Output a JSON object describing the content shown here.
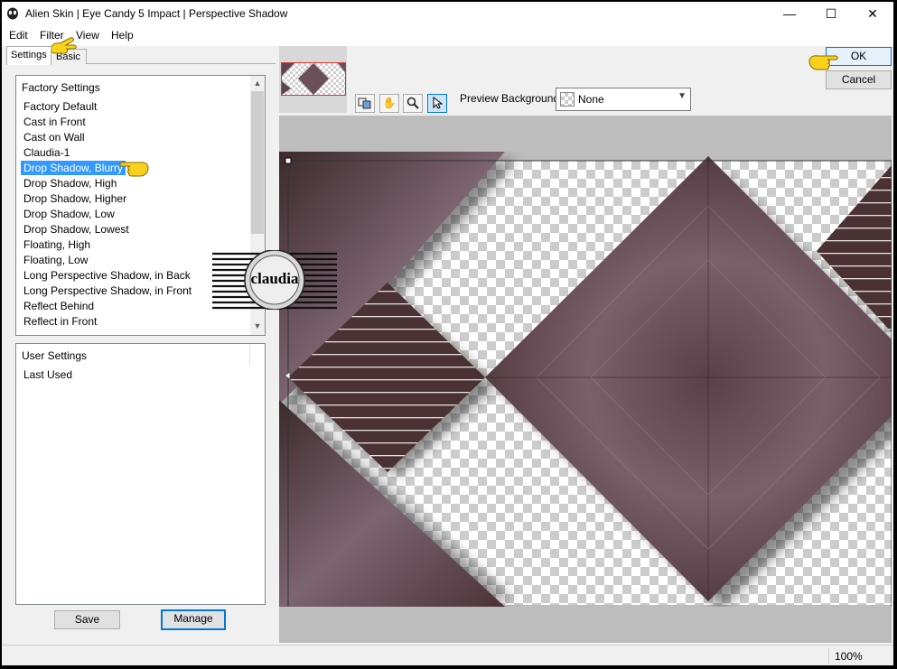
{
  "window": {
    "title": "Alien Skin | Eye Candy 5 Impact | Perspective Shadow",
    "controls": [
      "—",
      "☐",
      "✕"
    ]
  },
  "menu": [
    "Edit",
    "Filter",
    "View",
    "Help"
  ],
  "tabs": [
    {
      "label": "Settings",
      "active": true
    },
    {
      "label": "Basic",
      "active": false
    }
  ],
  "factory_settings": {
    "header": "Factory Settings",
    "items": [
      "Factory Default",
      "Cast in Front",
      "Cast on Wall",
      "Claudia-1",
      "Drop Shadow, Blurry",
      "Drop Shadow, High",
      "Drop Shadow, Higher",
      "Drop Shadow, Low",
      "Drop Shadow, Lowest",
      "Floating, High",
      "Floating, Low",
      "Long Perspective Shadow, in Back",
      "Long Perspective Shadow, in Front",
      "Reflect Behind",
      "Reflect in Front"
    ],
    "selected": "Drop Shadow, Blurry"
  },
  "user_settings": {
    "header": "User Settings",
    "items": [
      "Last Used"
    ]
  },
  "buttons": {
    "save": "Save",
    "manage": "Manage",
    "ok": "OK",
    "cancel": "Cancel"
  },
  "toolbar": {
    "icons": [
      "compare-icon",
      "hand-icon",
      "zoom-icon",
      "pointer-icon"
    ],
    "active": "pointer-icon"
  },
  "preview_background": {
    "label": "Preview Background:",
    "value": "None"
  },
  "watermark": {
    "text": "claudia"
  },
  "status": {
    "zoom": "100%"
  },
  "colors": {
    "selection": "#3399ff",
    "accent_button_border": "#0078d7",
    "wood_dark": "#3d2a2a",
    "wood_light": "#8a6f78",
    "pointer_hand": "#f7d11c"
  }
}
